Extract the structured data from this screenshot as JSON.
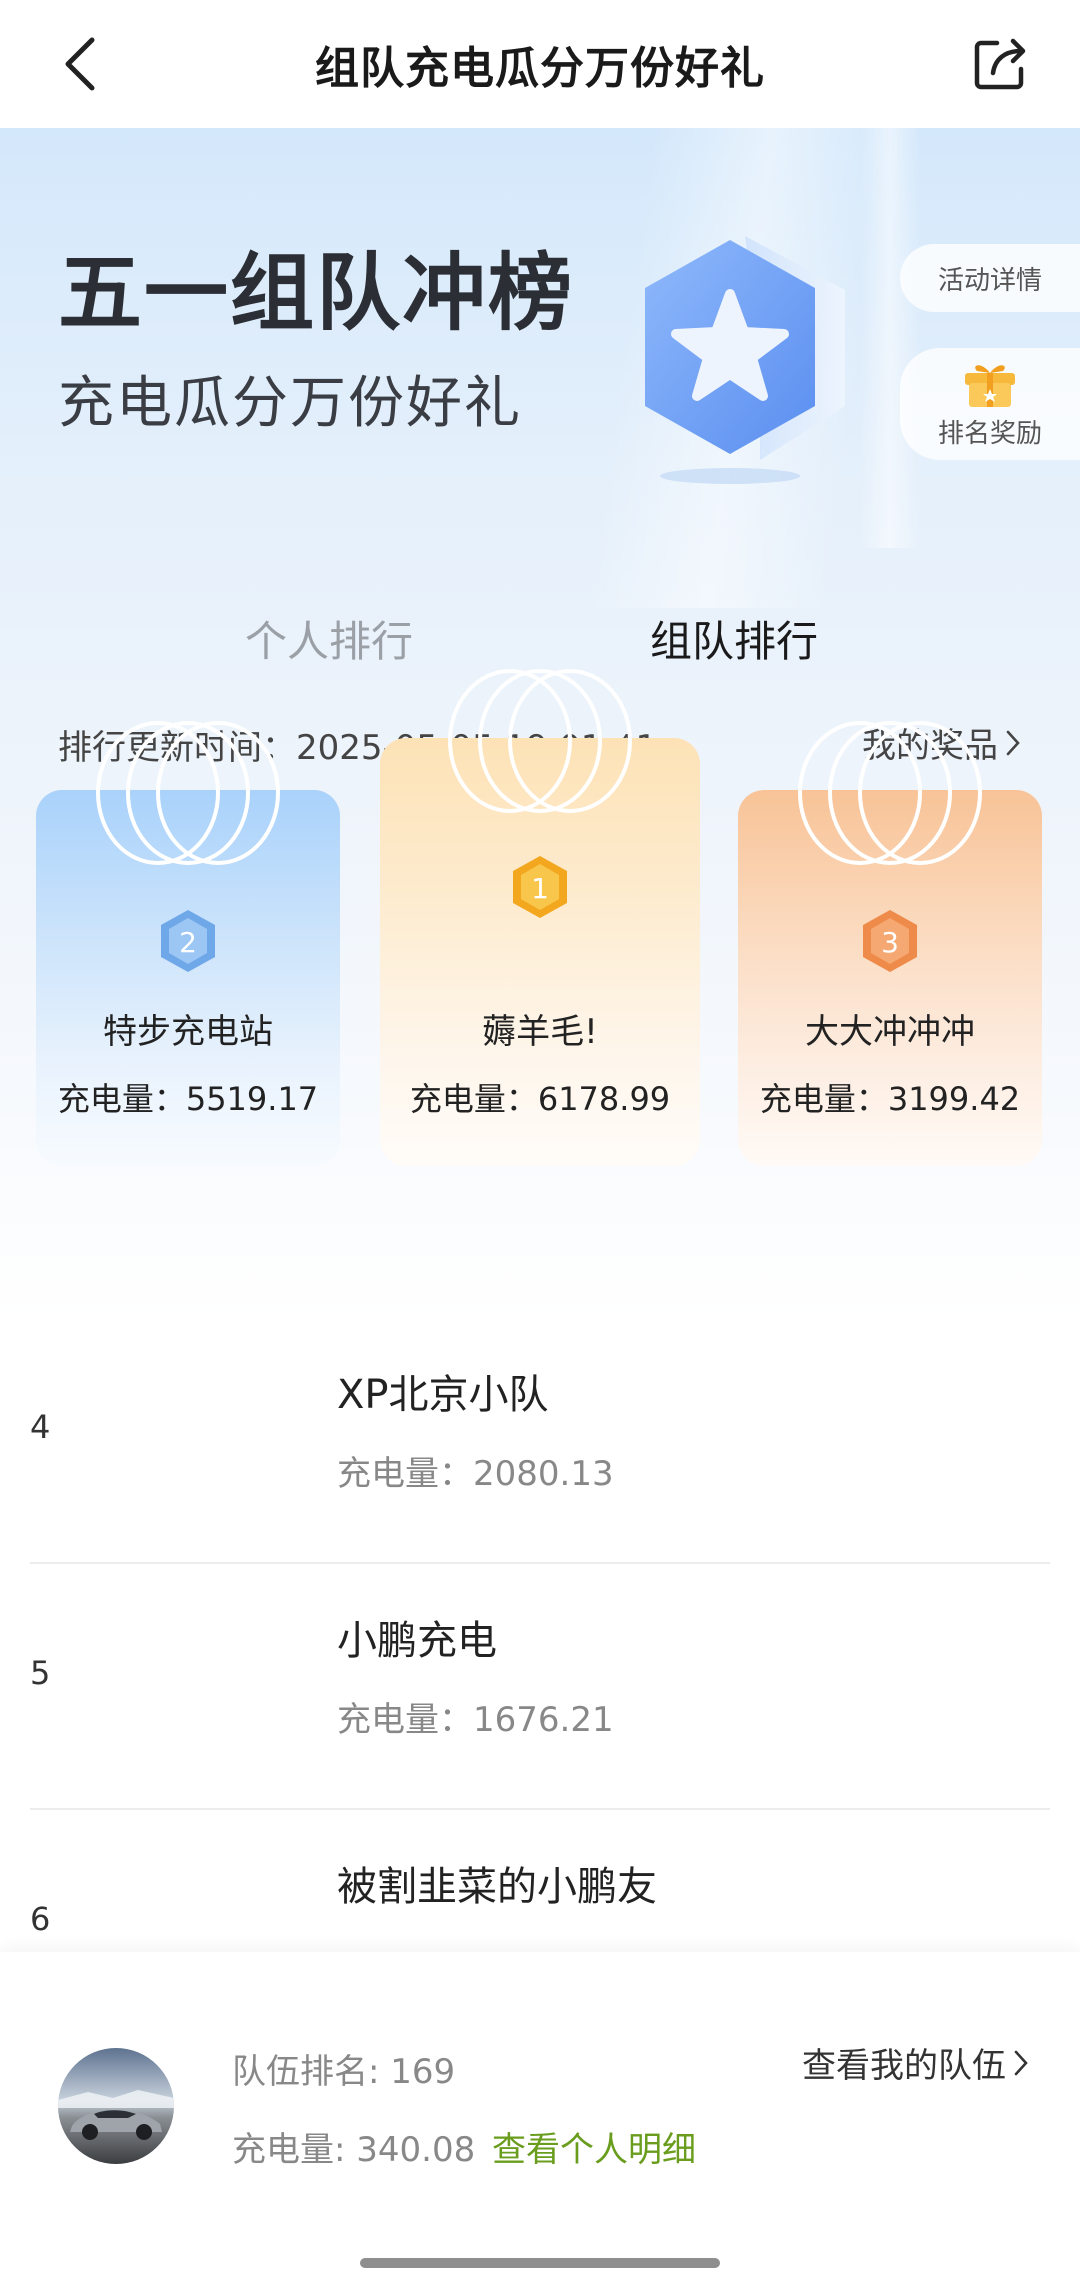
{
  "header": {
    "title": "组队充电瓜分万份好礼",
    "back_icon": "back-arrow-icon",
    "share_icon": "share-icon"
  },
  "hero": {
    "title": "五一组队冲榜",
    "subtitle": "充电瓜分万份好礼",
    "detail_label": "活动详情",
    "reward_label": "排名奖励"
  },
  "tabs": {
    "personal": "个人排行",
    "team": "组队排行",
    "active": "team"
  },
  "update_time": "排行更新时间：2025-05-05 19:01:41",
  "my_prize": "我的奖品",
  "podium": {
    "first": {
      "rank": "1",
      "name": "薅羊毛!",
      "charge": "充电量：6178.99"
    },
    "second": {
      "rank": "2",
      "name": "特步充电站",
      "charge": "充电量：5519.17"
    },
    "third": {
      "rank": "3",
      "name": "大大冲冲冲",
      "charge": "充电量：3199.42"
    }
  },
  "list": [
    {
      "rank": "4",
      "name": "XP北京小队",
      "charge": "充电量：2080.13"
    },
    {
      "rank": "5",
      "name": "小鹏充电",
      "charge": "充电量：1676.21"
    },
    {
      "rank": "6",
      "name": "被割韭菜的小鹏友",
      "charge": ""
    }
  ],
  "footer": {
    "team_rank": "队伍排名: 169",
    "charge": "充电量: 340.08",
    "personal_detail": "查看个人明细",
    "view_team": "查看我的队伍"
  },
  "colors": {
    "accent_green": "#6a9d1e",
    "hero_blue": "#d4e8fb",
    "gold": "#f7b733",
    "silver_blue": "#6ea8e8",
    "bronze": "#ee8a4a"
  }
}
